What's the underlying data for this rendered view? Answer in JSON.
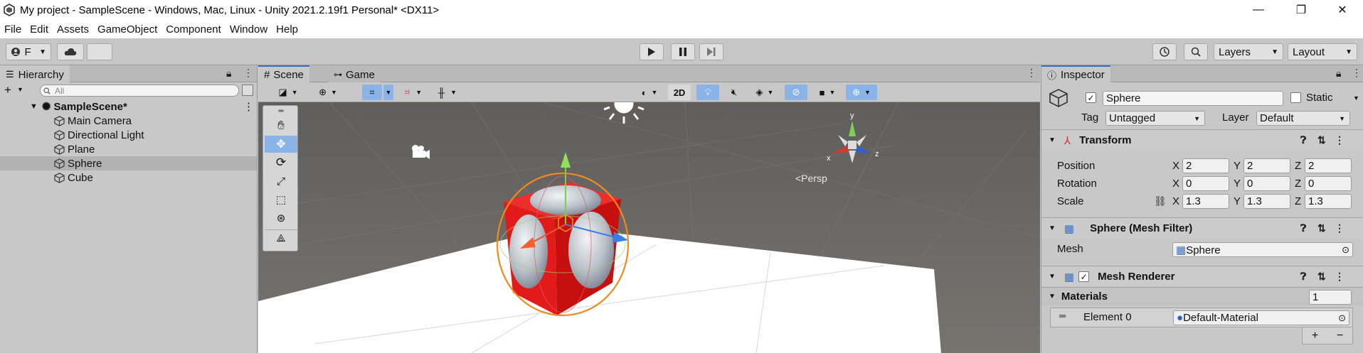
{
  "window": {
    "title": "My project - SampleScene - Windows, Mac, Linux - Unity 2021.2.19f1 Personal* <DX11>",
    "minimize": "—",
    "restore": "❐",
    "close": "✕"
  },
  "menu": [
    "File",
    "Edit",
    "Assets",
    "GameObject",
    "Component",
    "Window",
    "Help"
  ],
  "toolbar": {
    "account_label": "F",
    "layers_label": "Layers",
    "layout_label": "Layout"
  },
  "hierarchy": {
    "tab_label": "Hierarchy",
    "search_placeholder": "All",
    "scene_name": "SampleScene*",
    "items": [
      {
        "label": "Main Camera"
      },
      {
        "label": "Directional Light"
      },
      {
        "label": "Plane"
      },
      {
        "label": "Sphere",
        "selected": true
      },
      {
        "label": "Cube"
      }
    ]
  },
  "scene": {
    "tabs": [
      "Scene",
      "Game"
    ],
    "mode_2d": "2D",
    "gizmo_axes": {
      "x": "x",
      "y": "y",
      "z": "z"
    },
    "projection_label": "<Persp"
  },
  "inspector": {
    "tab_label": "Inspector",
    "object_name": "Sphere",
    "active": true,
    "static_label": "Static",
    "tag_label": "Tag",
    "tag_value": "Untagged",
    "layer_label": "Layer",
    "layer_value": "Default",
    "transform": {
      "title": "Transform",
      "position": {
        "label": "Position",
        "x": "2",
        "y": "2",
        "z": "2"
      },
      "rotation": {
        "label": "Rotation",
        "x": "0",
        "y": "0",
        "z": "0"
      },
      "scale": {
        "label": "Scale",
        "x": "1.3",
        "y": "1.3",
        "z": "1.3"
      }
    },
    "mesh_filter": {
      "title": "Sphere (Mesh Filter)",
      "mesh_label": "Mesh",
      "mesh_value": "Sphere"
    },
    "mesh_renderer": {
      "title": "Mesh Renderer",
      "materials_label": "Materials",
      "materials_count": "1",
      "element0_label": "Element 0",
      "element0_value": "Default-Material",
      "add": "+",
      "remove": "−"
    },
    "axis_labels": {
      "x": "X",
      "y": "Y",
      "z": "Z"
    }
  },
  "colors": {
    "accent": "#3a72c0",
    "selected_tool": "#8ab3e8",
    "cube_red": "#e02020",
    "sky": "#6b6a69"
  }
}
